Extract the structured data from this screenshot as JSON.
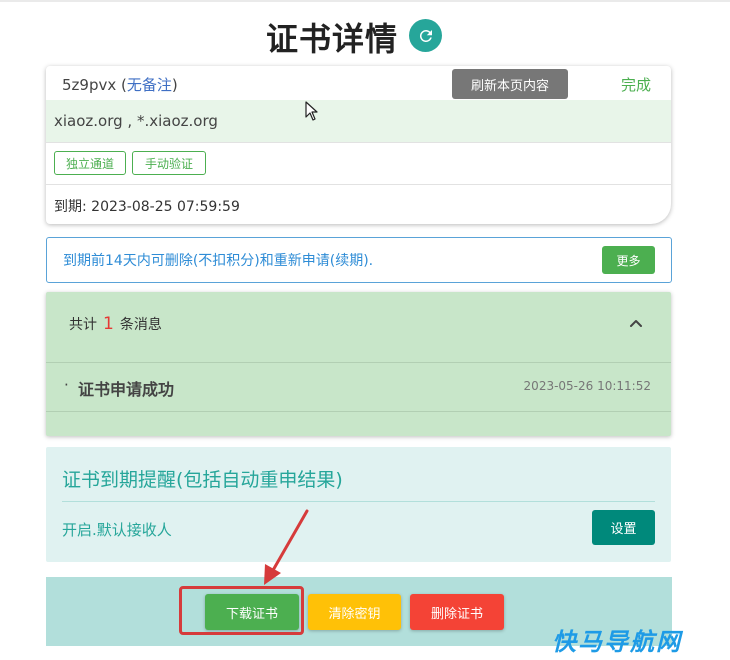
{
  "header": {
    "title": "证书详情",
    "refresh_icon": "refresh-icon"
  },
  "cert_card": {
    "cert_id": "5z9pvx",
    "note_open": " (",
    "note_text": "无备注",
    "note_close": ")",
    "refresh_button": "刷新本页内容",
    "status": "完成",
    "domains": "xiaoz.org , *.xiaoz.org",
    "tags": [
      "独立通道",
      "手动验证"
    ],
    "expiry": "到期: 2023-08-25 07:59:59"
  },
  "renew_notice": {
    "message": "到期前14天内可删除(不扣积分)和重新申请(续期).",
    "more_button": "更多"
  },
  "messages": {
    "count_prefix": "共计",
    "count": "1",
    "count_suffix": "条消息",
    "items": [
      {
        "bullet": "·",
        "text": "证书申请成功",
        "time": "2023-05-26 10:11:52"
      }
    ]
  },
  "reminder": {
    "title": "证书到期提醒(包括自动重申结果)",
    "status_text": "开启.默认接收人",
    "settings_button": "设置"
  },
  "actions": {
    "download": "下载证书",
    "clear_key": "清除密钥",
    "delete_cert": "删除证书"
  },
  "watermark": "快马导航网",
  "colors": {
    "accent": "#26a69a",
    "success": "#4caf50",
    "warning": "#ffc107",
    "danger": "#f44336",
    "annotation": "#d63b3b"
  }
}
